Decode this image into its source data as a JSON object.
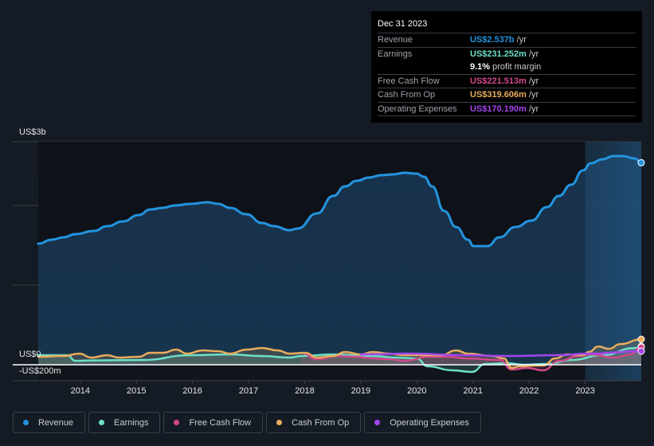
{
  "tooltip": {
    "date": "Dec 31 2023",
    "rows": [
      {
        "label": "Revenue",
        "value": "US$2.537b",
        "unit": "/yr",
        "color": "#2394df"
      },
      {
        "label": "Earnings",
        "value": "US$231.252m",
        "unit": "/yr",
        "color": "#6ce0c9"
      },
      {
        "label": "",
        "value": "9.1%",
        "unit": "profit margin",
        "color": "#ffffff"
      },
      {
        "label": "Free Cash Flow",
        "value": "US$221.513m",
        "unit": "/yr",
        "color": "#d2488a"
      },
      {
        "label": "Cash From Op",
        "value": "US$319.606m",
        "unit": "/yr",
        "color": "#e8ac5b"
      },
      {
        "label": "Operating Expenses",
        "value": "US$170.190m",
        "unit": "/yr",
        "color": "#a345ec"
      }
    ]
  },
  "chart_data": {
    "type": "area",
    "title": "",
    "xlabel": "",
    "ylabel": "",
    "y_axis_labels": {
      "top": "US$3b",
      "zero": "US$0",
      "bottom": "-US$200m"
    },
    "ylim_millions": [
      -200,
      2800
    ],
    "xlim_years": [
      2013.25,
      2024.0
    ],
    "x_ticks": [
      "2014",
      "2015",
      "2016",
      "2017",
      "2018",
      "2019",
      "2020",
      "2021",
      "2022",
      "2023"
    ],
    "highlight_from_year": 2023.0,
    "grid": true,
    "legend_position": "bottom-left",
    "series": [
      {
        "name": "Revenue",
        "color": "#2394df",
        "fill": true,
        "points": [
          [
            2013.25,
            1520
          ],
          [
            2013.49,
            1570
          ],
          [
            2013.7,
            1600
          ],
          [
            2013.91,
            1640
          ],
          [
            2014.24,
            1680
          ],
          [
            2014.48,
            1740
          ],
          [
            2014.76,
            1800
          ],
          [
            2015.04,
            1880
          ],
          [
            2015.25,
            1950
          ],
          [
            2015.47,
            1970
          ],
          [
            2015.68,
            2000
          ],
          [
            2015.96,
            2020
          ],
          [
            2016.27,
            2040
          ],
          [
            2016.46,
            2020
          ],
          [
            2016.67,
            1970
          ],
          [
            2016.96,
            1890
          ],
          [
            2017.24,
            1780
          ],
          [
            2017.45,
            1740
          ],
          [
            2017.73,
            1690
          ],
          [
            2017.87,
            1710
          ],
          [
            2018.22,
            1900
          ],
          [
            2018.51,
            2120
          ],
          [
            2018.72,
            2240
          ],
          [
            2018.93,
            2310
          ],
          [
            2019.14,
            2350
          ],
          [
            2019.36,
            2380
          ],
          [
            2019.57,
            2390
          ],
          [
            2019.78,
            2410
          ],
          [
            2019.99,
            2400
          ],
          [
            2020.13,
            2360
          ],
          [
            2020.27,
            2240
          ],
          [
            2020.49,
            1930
          ],
          [
            2020.7,
            1730
          ],
          [
            2020.91,
            1570
          ],
          [
            2021.01,
            1490
          ],
          [
            2021.26,
            1490
          ],
          [
            2021.47,
            1600
          ],
          [
            2021.76,
            1730
          ],
          [
            2022.04,
            1810
          ],
          [
            2022.32,
            1980
          ],
          [
            2022.53,
            2120
          ],
          [
            2022.75,
            2260
          ],
          [
            2022.96,
            2440
          ],
          [
            2023.1,
            2530
          ],
          [
            2023.31,
            2580
          ],
          [
            2023.5,
            2620
          ],
          [
            2023.67,
            2620
          ],
          [
            2023.88,
            2590
          ],
          [
            2024.0,
            2537
          ]
        ]
      },
      {
        "name": "Earnings",
        "color": "#6ce0c9",
        "fill": true,
        "points": [
          [
            2013.25,
            120
          ],
          [
            2013.77,
            120
          ],
          [
            2013.91,
            50
          ],
          [
            2014.24,
            55
          ],
          [
            2015.11,
            60
          ],
          [
            2015.96,
            120
          ],
          [
            2016.67,
            130
          ],
          [
            2017.24,
            110
          ],
          [
            2017.73,
            90
          ],
          [
            2017.94,
            110
          ],
          [
            2018.51,
            130
          ],
          [
            2019.21,
            110
          ],
          [
            2019.64,
            90
          ],
          [
            2019.99,
            80
          ],
          [
            2020.2,
            -20
          ],
          [
            2020.63,
            -70
          ],
          [
            2020.98,
            -90
          ],
          [
            2021.22,
            10
          ],
          [
            2021.62,
            20
          ],
          [
            2021.9,
            0
          ],
          [
            2022.32,
            10
          ],
          [
            2022.75,
            60
          ],
          [
            2023.31,
            120
          ],
          [
            2023.88,
            210
          ],
          [
            2024.0,
            231
          ]
        ]
      },
      {
        "name": "Free Cash Flow",
        "color": "#d2488a",
        "fill": true,
        "points": [
          [
            2017.94,
            150
          ],
          [
            2018.22,
            70
          ],
          [
            2018.58,
            110
          ],
          [
            2018.93,
            100
          ],
          [
            2019.21,
            80
          ],
          [
            2019.5,
            70
          ],
          [
            2019.78,
            50
          ],
          [
            2020.2,
            100
          ],
          [
            2020.56,
            100
          ],
          [
            2020.91,
            80
          ],
          [
            2021.48,
            60
          ],
          [
            2021.69,
            -60
          ],
          [
            2021.97,
            -40
          ],
          [
            2022.25,
            -70
          ],
          [
            2022.54,
            50
          ],
          [
            2022.89,
            110
          ],
          [
            2023.1,
            130
          ],
          [
            2023.53,
            90
          ],
          [
            2023.81,
            130
          ],
          [
            2024.0,
            221
          ]
        ]
      },
      {
        "name": "Cash From Op",
        "color": "#e8ac5b",
        "fill": true,
        "points": [
          [
            2013.25,
            100
          ],
          [
            2013.7,
            110
          ],
          [
            2013.98,
            140
          ],
          [
            2014.2,
            90
          ],
          [
            2014.48,
            120
          ],
          [
            2014.69,
            90
          ],
          [
            2015.04,
            100
          ],
          [
            2015.25,
            150
          ],
          [
            2015.47,
            150
          ],
          [
            2015.71,
            190
          ],
          [
            2015.9,
            140
          ],
          [
            2016.18,
            180
          ],
          [
            2016.46,
            170
          ],
          [
            2016.67,
            140
          ],
          [
            2016.96,
            190
          ],
          [
            2017.24,
            210
          ],
          [
            2017.52,
            180
          ],
          [
            2017.73,
            140
          ],
          [
            2018.01,
            150
          ],
          [
            2018.22,
            90
          ],
          [
            2018.51,
            110
          ],
          [
            2018.72,
            160
          ],
          [
            2019.0,
            130
          ],
          [
            2019.21,
            160
          ],
          [
            2019.5,
            140
          ],
          [
            2019.78,
            120
          ],
          [
            2020.07,
            120
          ],
          [
            2020.43,
            120
          ],
          [
            2020.7,
            180
          ],
          [
            2020.91,
            140
          ],
          [
            2021.34,
            110
          ],
          [
            2021.55,
            80
          ],
          [
            2021.69,
            -40
          ],
          [
            2021.83,
            -20
          ],
          [
            2022.11,
            -10
          ],
          [
            2022.25,
            -10
          ],
          [
            2022.47,
            80
          ],
          [
            2022.68,
            130
          ],
          [
            2022.96,
            120
          ],
          [
            2023.06,
            160
          ],
          [
            2023.24,
            230
          ],
          [
            2023.42,
            200
          ],
          [
            2023.63,
            260
          ],
          [
            2024.0,
            320
          ]
        ]
      },
      {
        "name": "Operating Expenses",
        "color": "#a345ec",
        "fill": false,
        "points": [
          [
            2019.0,
            130
          ],
          [
            2019.95,
            140
          ],
          [
            2020.8,
            120
          ],
          [
            2021.65,
            110
          ],
          [
            2022.5,
            120
          ],
          [
            2023.07,
            140
          ],
          [
            2024.0,
            170
          ]
        ]
      }
    ]
  },
  "legend": [
    {
      "label": "Revenue",
      "color": "#2394df"
    },
    {
      "label": "Earnings",
      "color": "#6ce0c9"
    },
    {
      "label": "Free Cash Flow",
      "color": "#d2488a"
    },
    {
      "label": "Cash From Op",
      "color": "#e8ac5b"
    },
    {
      "label": "Operating Expenses",
      "color": "#a345ec"
    }
  ]
}
